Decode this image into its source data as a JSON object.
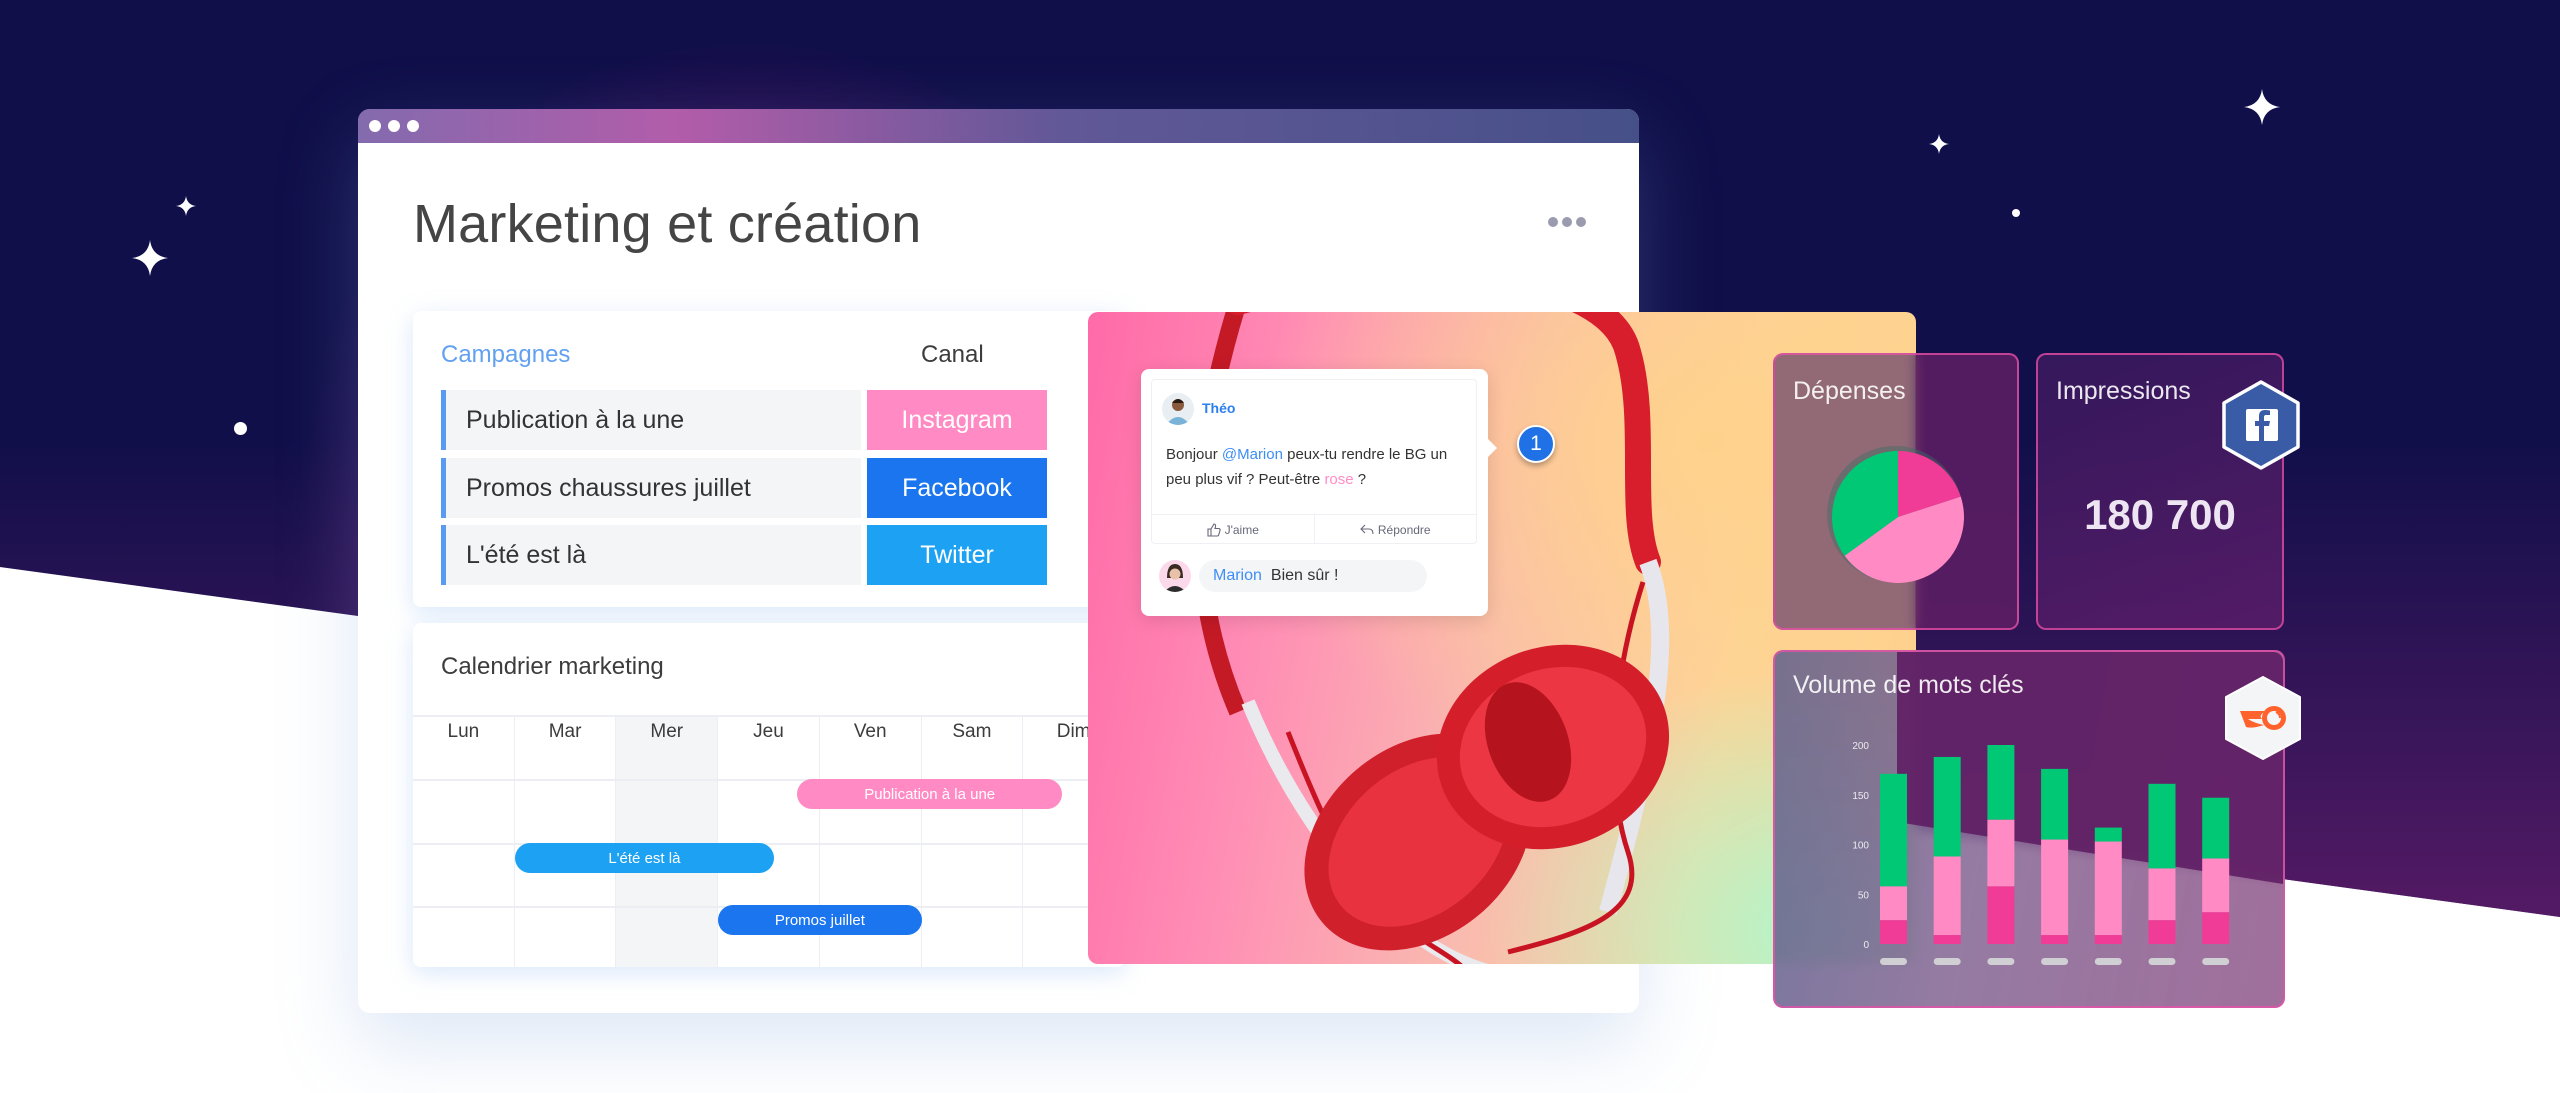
{
  "window": {
    "title": "Marketing et création",
    "menu_icon": "more-horizontal-icon"
  },
  "campaigns": {
    "header_campaigns": "Campagnes",
    "header_canal": "Canal",
    "rows": [
      {
        "name": "Publication à la une",
        "canal": "Instagram",
        "canal_color": "#ff8ac4"
      },
      {
        "name": "Promos chaussures juillet",
        "canal": "Facebook",
        "canal_color": "#1a75ee"
      },
      {
        "name": "L'été est là",
        "canal": "Twitter",
        "canal_color": "#1da1f2"
      }
    ]
  },
  "calendar": {
    "title": "Calendrier marketing",
    "days": [
      "Lun",
      "Mar",
      "Mer",
      "Jeu",
      "Ven",
      "Sam",
      "Dim"
    ],
    "highlighted_day": "Mer",
    "events": [
      {
        "label": "Publication à la une",
        "color": "#ff8ac4",
        "start_day": "Ven",
        "end_day": "Dim"
      },
      {
        "label": "L'été est là",
        "color": "#1da1f2",
        "start_day": "Mar",
        "end_day": "Jeu"
      },
      {
        "label": "Promos juillet",
        "color": "#1a75ee",
        "start_day": "Jeu",
        "end_day": "Ven"
      }
    ]
  },
  "comment": {
    "author": "Théo",
    "text_before": "Bonjour ",
    "mention": "@Marion",
    "text_middle": " peux-tu rendre le BG un peu plus vif ? Peut-être ",
    "pink_word": "rose",
    "text_after": " ?",
    "like_label": "J'aime",
    "reply_label": "Répondre",
    "reply": {
      "author": "Marion",
      "text": "Bien sûr !"
    },
    "notification_count": "1"
  },
  "stats": {
    "depenses": {
      "title": "Dépenses"
    },
    "impressions": {
      "title": "Impressions",
      "value": "180 700",
      "source_icon": "facebook-icon"
    },
    "volume": {
      "title": "Volume de mots clés",
      "source_icon": "semrush-icon"
    }
  },
  "colors": {
    "green": "#00c875",
    "pink_light": "#ff8ac4",
    "pink_dark": "#f03c96",
    "background_navy": "#100f4a"
  },
  "chart_data": [
    {
      "type": "pie",
      "title": "Dépenses",
      "slices": [
        {
          "label": "segment-1",
          "value": 20,
          "color": "#f03c96"
        },
        {
          "label": "segment-2",
          "value": 45,
          "color": "#ff8ac4"
        },
        {
          "label": "segment-3",
          "value": 35,
          "color": "#00c875"
        }
      ]
    },
    {
      "type": "bar",
      "stacked": true,
      "title": "Volume de mots clés",
      "categories": [
        "",
        "",
        "",
        "",
        "",
        "",
        ""
      ],
      "yticks": [
        0,
        50,
        100,
        150,
        200
      ],
      "ylim": [
        0,
        200
      ],
      "series": [
        {
          "name": "segment-dark-pink",
          "color": "#f03c96",
          "values": [
            24,
            9,
            58,
            9,
            9,
            24,
            32
          ]
        },
        {
          "name": "segment-light-pink",
          "color": "#ff8ac4",
          "values": [
            34,
            79,
            67,
            96,
            94,
            52,
            54
          ]
        },
        {
          "name": "segment-green",
          "color": "#00c875",
          "values": [
            113,
            100,
            75,
            71,
            14,
            85,
            61
          ]
        }
      ]
    }
  ]
}
